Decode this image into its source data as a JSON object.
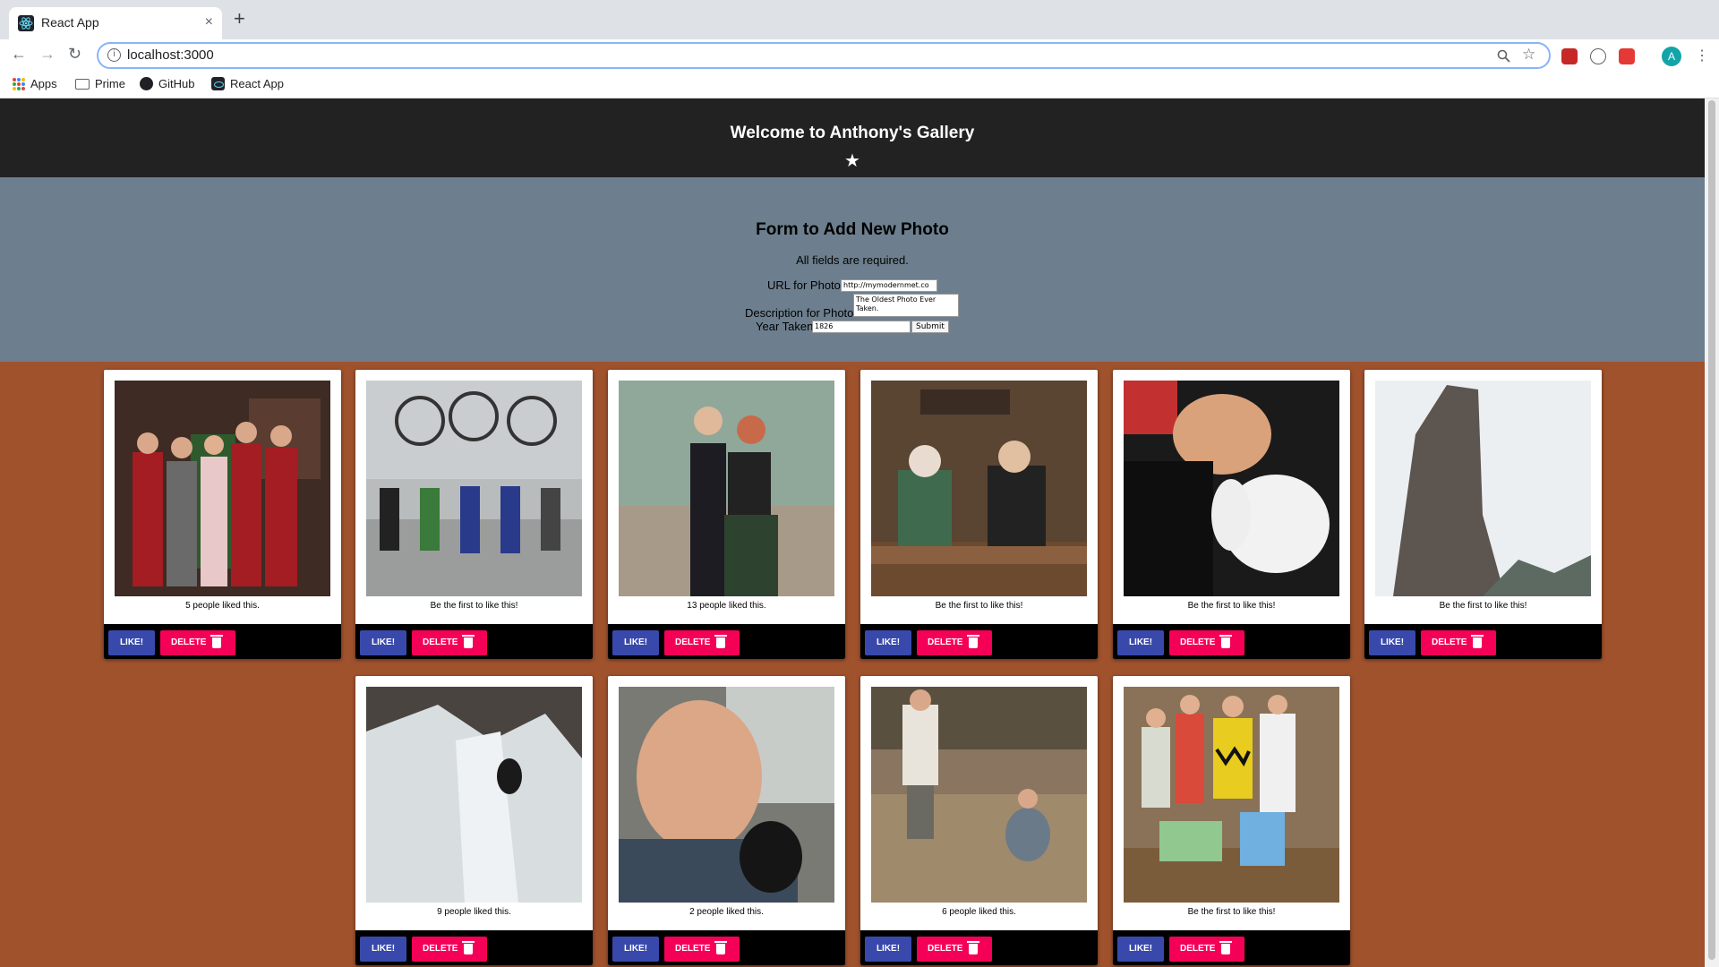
{
  "browser": {
    "tab_title": "React App",
    "tab_close": "×",
    "new_tab": "+",
    "url": "localhost:3000",
    "bookmarks": [
      "Apps",
      "Prime",
      "GitHub",
      "React App"
    ],
    "profile_initial": "A"
  },
  "header": {
    "title": "Welcome to Anthony's Gallery",
    "star": "★"
  },
  "form": {
    "title": "Form to Add New Photo",
    "note": "All fields are required.",
    "url_label": "URL for Photo",
    "url_value": "http://mymodernmet.co",
    "description_label": "Description for Photo",
    "description_value": "The Oldest Photo Ever Taken.",
    "year_label": "Year Taken",
    "year_value": "1826",
    "submit_label": "Submit"
  },
  "cards": [
    {
      "likes_text": "5 people liked this.",
      "like_label": "LIKE!",
      "delete_label": "DELETE"
    },
    {
      "likes_text": "Be the first to like this!",
      "like_label": "LIKE!",
      "delete_label": "DELETE"
    },
    {
      "likes_text": "13 people liked this.",
      "like_label": "LIKE!",
      "delete_label": "DELETE"
    },
    {
      "likes_text": "Be the first to like this!",
      "like_label": "LIKE!",
      "delete_label": "DELETE"
    },
    {
      "likes_text": "Be the first to like this!",
      "like_label": "LIKE!",
      "delete_label": "DELETE"
    },
    {
      "likes_text": "Be the first to like this!",
      "like_label": "LIKE!",
      "delete_label": "DELETE"
    },
    {
      "likes_text": "9 people liked this.",
      "like_label": "LIKE!",
      "delete_label": "DELETE"
    },
    {
      "likes_text": "2 people liked this.",
      "like_label": "LIKE!",
      "delete_label": "DELETE"
    },
    {
      "likes_text": "6 people liked this.",
      "like_label": "LIKE!",
      "delete_label": "DELETE"
    },
    {
      "likes_text": "Be the first to like this!",
      "like_label": "LIKE!",
      "delete_label": "DELETE"
    }
  ],
  "colors": {
    "header_bg": "#222222",
    "form_bg": "#6d7f8e",
    "gallery_bg": "#a0522d",
    "like_button": "#3949ab",
    "delete_button": "#f50057"
  }
}
